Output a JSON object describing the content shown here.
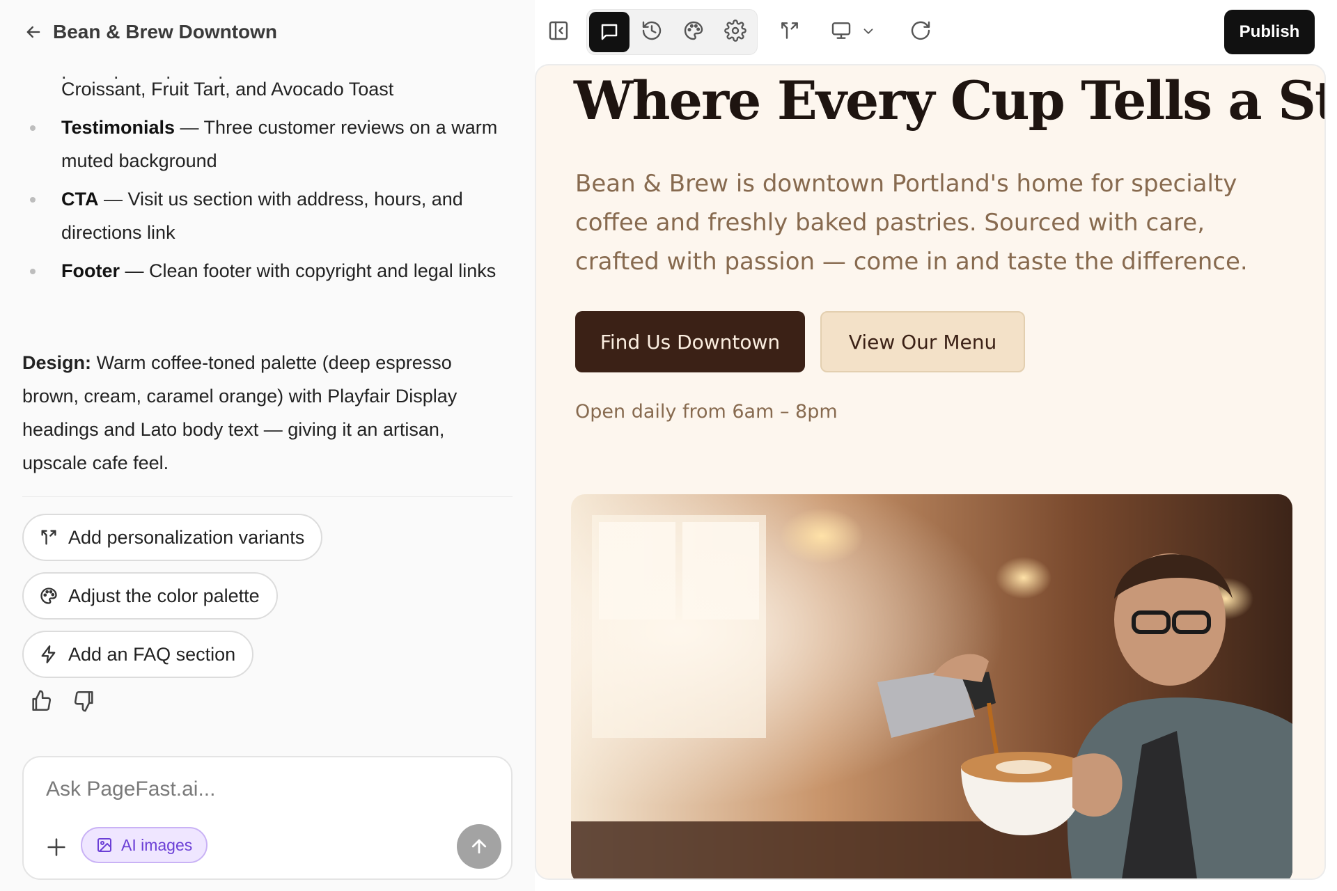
{
  "header": {
    "project_title": "Bean & Brew Downtown"
  },
  "chat": {
    "partial_line": "Croissant, Fruit Tart, and Avocado Toast",
    "sections": [
      {
        "name": "Testimonials",
        "desc": " — Three customer reviews on a warm muted background"
      },
      {
        "name": "CTA",
        "desc": " — Visit us section with address, hours, and directions link"
      },
      {
        "name": "Footer",
        "desc": " — Clean footer with copyright and legal links"
      }
    ],
    "design_label": "Design:",
    "design_text": " Warm coffee-toned palette (deep espresso brown, cream, caramel orange) with Playfair Display headings and Lato body text — giving it an artisan, upscale cafe feel."
  },
  "suggestions": [
    {
      "label": "Add personalization variants",
      "icon": "split-arrows-icon"
    },
    {
      "label": "Adjust the color palette",
      "icon": "palette-icon"
    },
    {
      "label": "Add an FAQ section",
      "icon": "lightning-icon"
    }
  ],
  "composer": {
    "placeholder": "Ask PageFast.ai...",
    "ai_images_label": "AI images"
  },
  "toolbar": {
    "publish_label": "Publish",
    "icons": [
      "sidebar-toggle-icon",
      "chat-icon",
      "history-icon",
      "palette-icon",
      "settings-icon",
      "split-arrows-icon",
      "desktop-icon",
      "chevron-down-icon",
      "refresh-icon"
    ]
  },
  "preview": {
    "hero_title": "Where Every Cup Tells a Story",
    "hero_subtitle": "Bean & Brew is downtown Portland's home for specialty coffee and freshly baked pastries. Sourced with care, crafted with passion — come in and taste the difference.",
    "primary_cta": "Find Us Downtown",
    "secondary_cta": "View Our Menu",
    "hours": "Open daily from 6am – 8pm"
  },
  "colors": {
    "espresso": "#3b2116",
    "cream": "#fdf6ee",
    "caramel_text": "#876a4f",
    "button_light": "#f3e1c8",
    "ai_chip_purple": "#6b3fd6"
  }
}
